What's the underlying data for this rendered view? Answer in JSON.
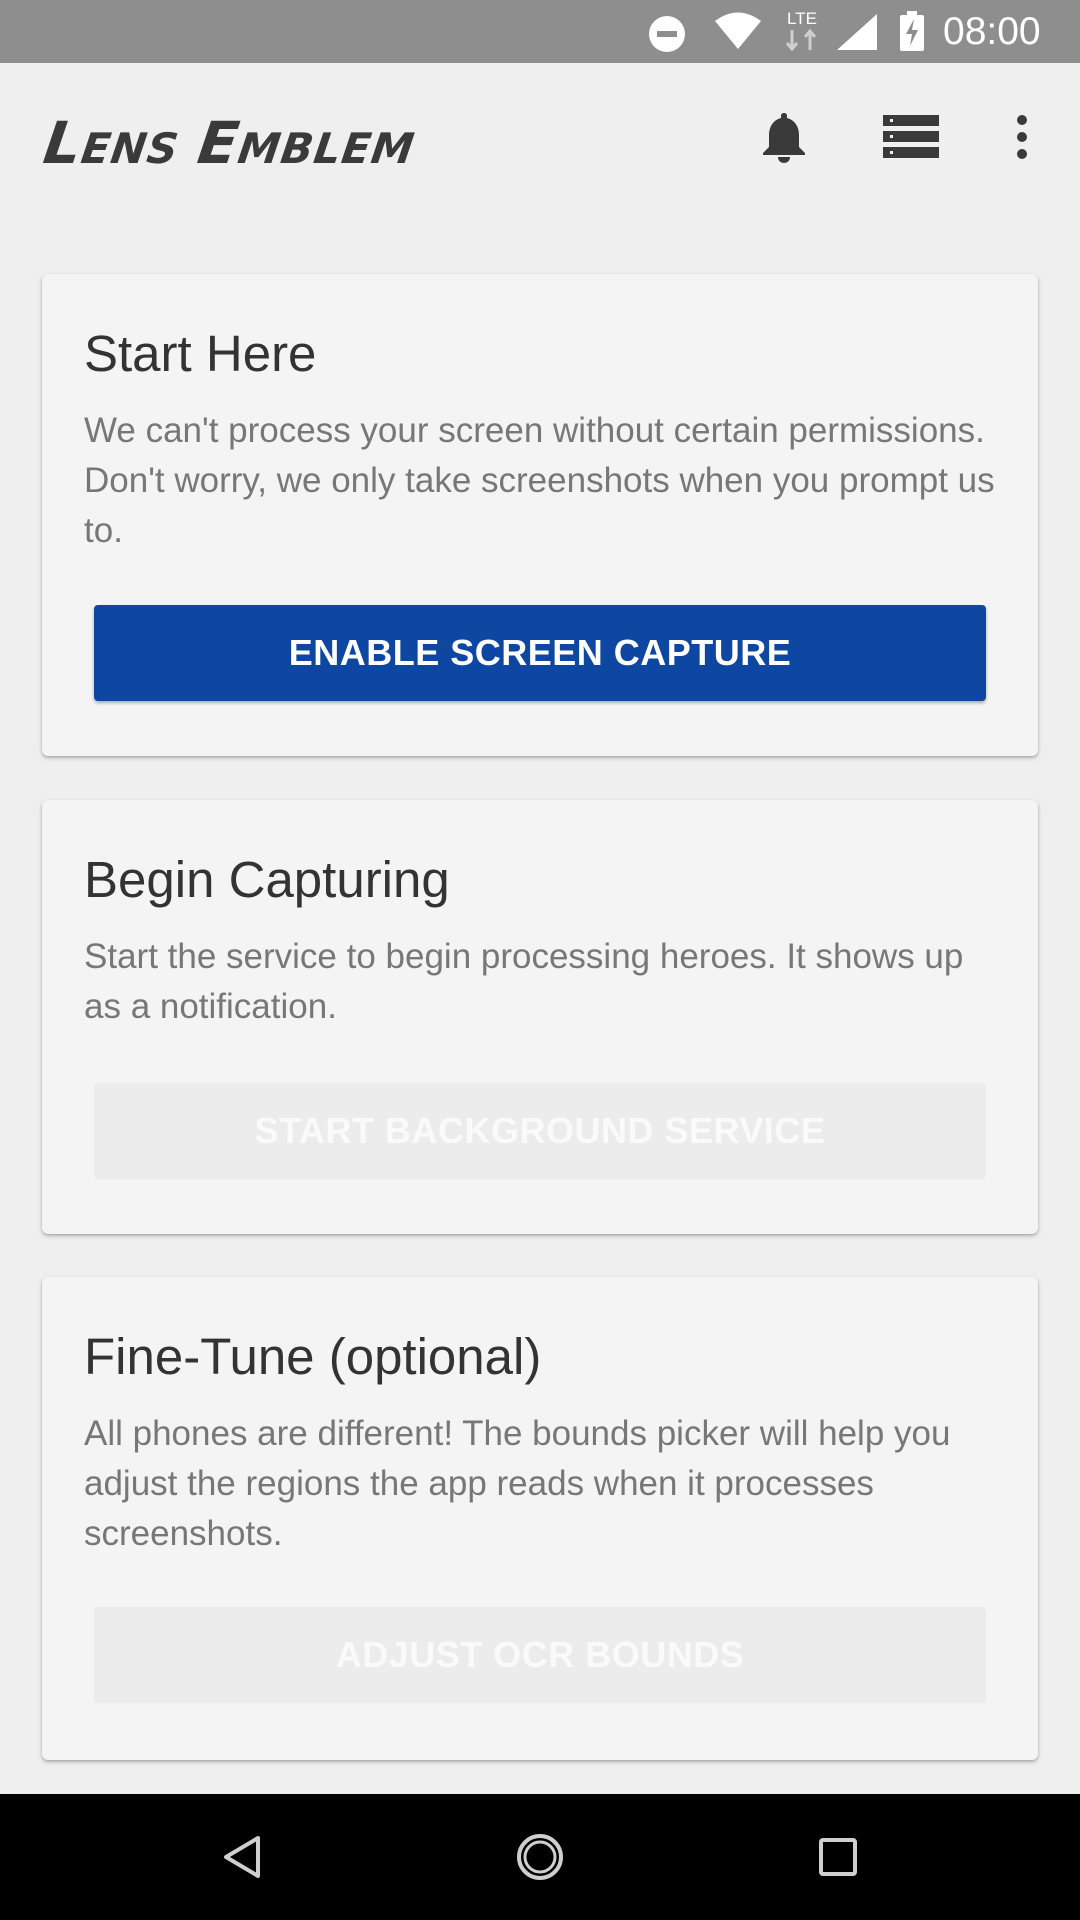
{
  "status_bar": {
    "time": "08:00",
    "icons": [
      "do-not-disturb-icon",
      "wifi-icon",
      "lte-icon",
      "cell-signal-icon",
      "battery-charging-icon"
    ],
    "lte_label": "LTE"
  },
  "app_bar": {
    "title_part1_initial": "L",
    "title_part1_rest": "ENS",
    "title_part2_initial": "E",
    "title_part2_rest": "MBLEM",
    "actions": [
      "notifications-bell-icon",
      "list-icon",
      "more-vert-icon"
    ]
  },
  "cards": [
    {
      "title": "Start Here",
      "body": "We can't process your screen without certain permissions. Don't worry, we only take screenshots when you prompt us to.",
      "button_label": "ENABLE SCREEN CAPTURE",
      "button_enabled": true
    },
    {
      "title": "Begin Capturing",
      "body": "Start the service to begin processing heroes. It shows up as a notification.",
      "button_label": "START BACKGROUND SERVICE",
      "button_enabled": false
    },
    {
      "title": "Fine-Tune (optional)",
      "body": "All phones are different! The bounds picker will help you adjust the regions the app reads when it processes screenshots.",
      "button_label": "ADJUST OCR BOUNDS",
      "button_enabled": false
    }
  ],
  "nav_bar": {
    "buttons": [
      "back-icon",
      "home-icon",
      "recents-icon"
    ]
  },
  "colors": {
    "status_bar": "#8e8e8e",
    "background": "#efefef",
    "card": "#f4f4f4",
    "primary_button": "#0e47a1",
    "disabled_button": "#ececec",
    "nav_bar": "#000000"
  }
}
